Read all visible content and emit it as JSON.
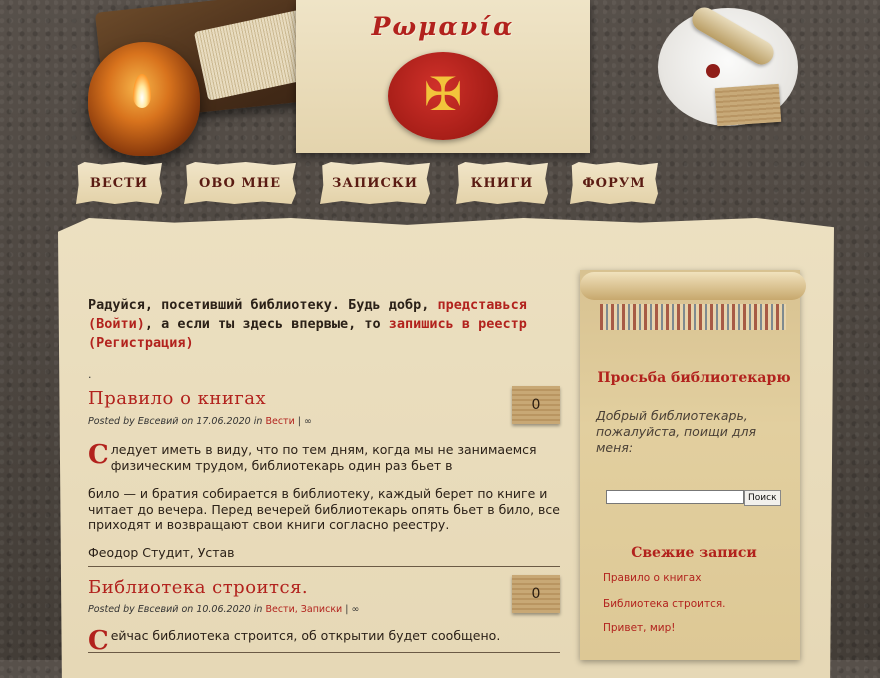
{
  "site": {
    "title": "Ρωμανία"
  },
  "nav": [
    {
      "label": "Вести"
    },
    {
      "label": "Obo мне"
    },
    {
      "label": "Записки"
    },
    {
      "label": "Книги"
    },
    {
      "label": "Форум"
    }
  ],
  "welcome": {
    "text1": "Радуйся, посетивший библиотеку. Будь добр,",
    "link1": "представься (Войти)",
    "text2": ", а если ты здесь впервые, то",
    "link2": "запишись в реестр (Регистрация)"
  },
  "posts": [
    {
      "title": "Правило о книгах",
      "posted_by": "Posted by",
      "author": "Евсевий",
      "on": "on",
      "date": "17.06.2020",
      "in": "in",
      "categories": "Вести",
      "sep": "| ∞",
      "comments": "0",
      "dropcap": "С",
      "body1": "ледует иметь в виду, что по тем дням, когда мы не занимаемся физическим трудом, библиотекарь один раз бьет в",
      "body2": "било — и братия собирается в библиотеку, каждый берет по книге и читает до вечера. Перед вечерей библиотекарь опять бьет в било, все приходят и возвращают свои книги согласно реестру.",
      "source": "Феодор Студит, Устав"
    },
    {
      "title": "Библиотека строится.",
      "posted_by": "Posted by",
      "author": "Евсевий",
      "on": "on",
      "date": "10.06.2020",
      "in": "in",
      "categories": "Вести, Записки",
      "sep": "| ∞",
      "comments": "0",
      "dropcap": "С",
      "body1": "ейчас библиотека строится, об открытии будет сообщено."
    }
  ],
  "sidebar": {
    "request_title": "Просьба библиотекарю",
    "request_text": "Добрый библиотекарь, пожалуйста, поищи для меня:",
    "search_value": "",
    "search_button": "Поиск",
    "recent_title": "Свежие записи",
    "recent": [
      "Правило о книгах",
      "Библиотека строится.",
      "Привет, мир!"
    ]
  }
}
